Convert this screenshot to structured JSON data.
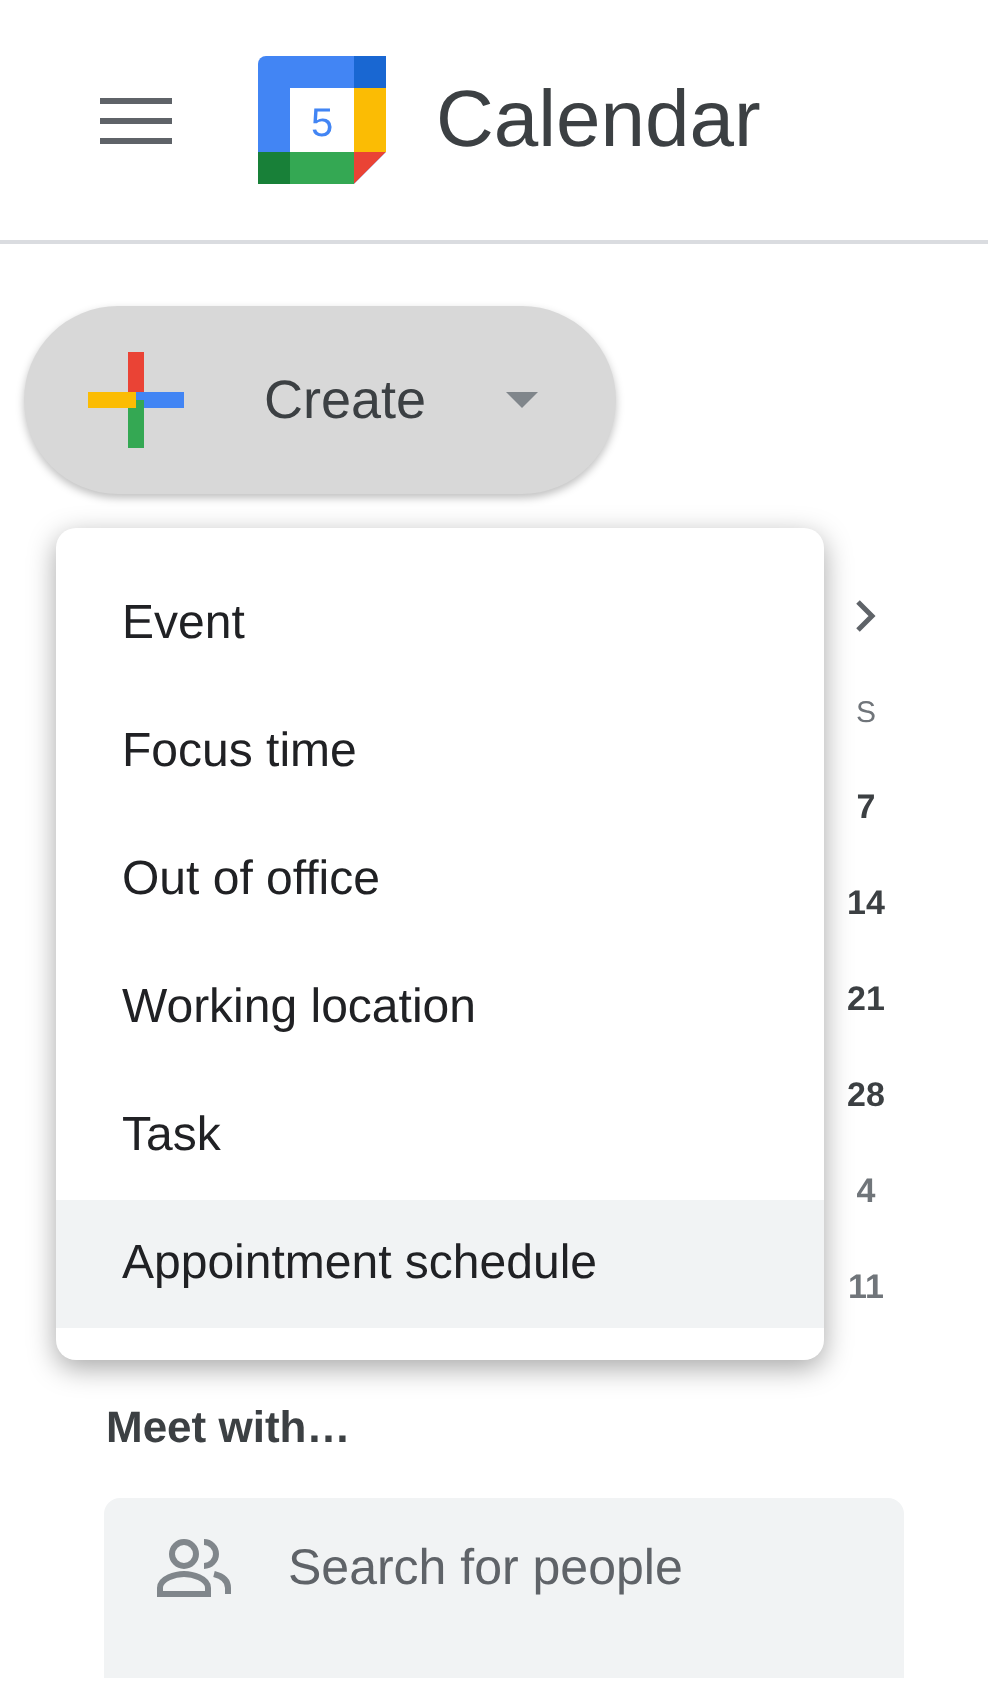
{
  "header": {
    "app_name": "Calendar",
    "logo_day": "5"
  },
  "create_button": {
    "label": "Create"
  },
  "create_menu": {
    "items": [
      {
        "label": "Event",
        "selected": false
      },
      {
        "label": "Focus time",
        "selected": false
      },
      {
        "label": "Out of office",
        "selected": false
      },
      {
        "label": "Working location",
        "selected": false
      },
      {
        "label": "Task",
        "selected": false
      },
      {
        "label": "Appointment schedule",
        "selected": true
      }
    ]
  },
  "mini_calendar": {
    "weekday": "S",
    "days": [
      {
        "text": "7",
        "muted": false
      },
      {
        "text": "14",
        "muted": false
      },
      {
        "text": "21",
        "muted": false
      },
      {
        "text": "28",
        "muted": false
      },
      {
        "text": "4",
        "muted": true
      },
      {
        "text": "11",
        "muted": true
      }
    ]
  },
  "meet_with": {
    "title": "Meet with…",
    "search": {
      "placeholder": "Search for people"
    }
  }
}
